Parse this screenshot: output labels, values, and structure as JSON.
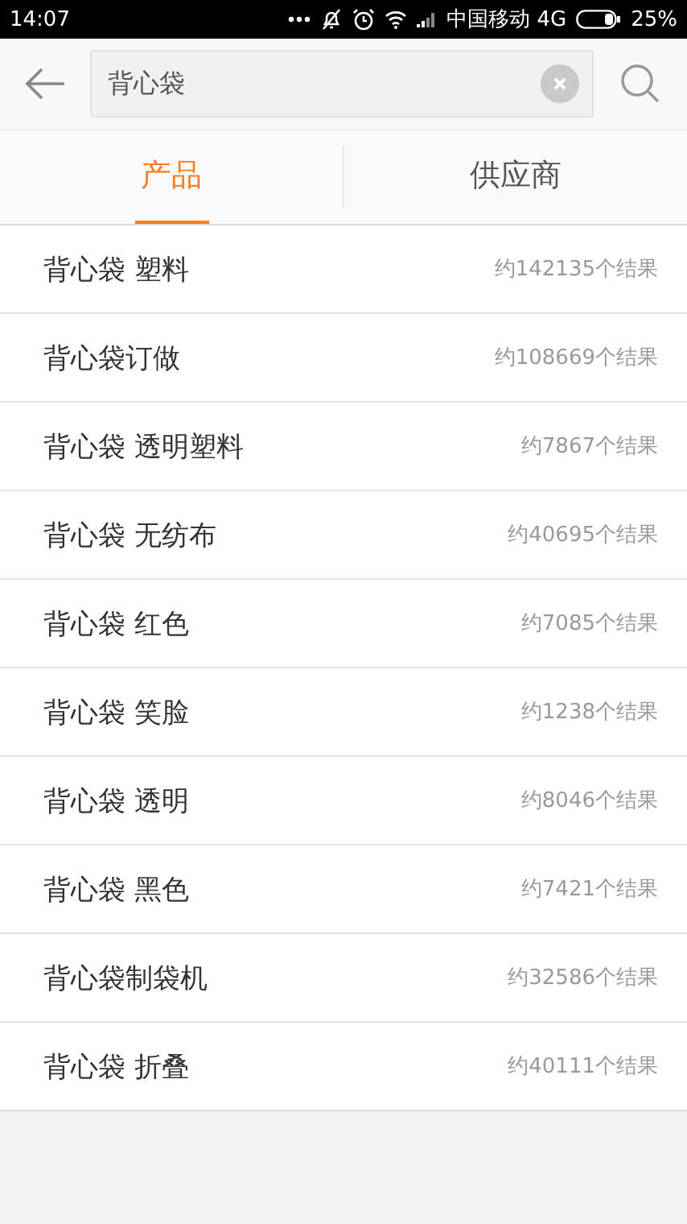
{
  "status_bar": {
    "time": "14:07",
    "carrier": "中国移动 4G",
    "battery": "25%"
  },
  "search": {
    "value": "背心袋"
  },
  "tabs": [
    {
      "label": "产品",
      "selected": true
    },
    {
      "label": "供应商",
      "selected": false
    }
  ],
  "results": [
    {
      "query": "背心袋 塑料",
      "count": "约142135个结果"
    },
    {
      "query": "背心袋订做",
      "count": "约108669个结果"
    },
    {
      "query": "背心袋 透明塑料",
      "count": "约7867个结果"
    },
    {
      "query": "背心袋 无纺布",
      "count": "约40695个结果"
    },
    {
      "query": "背心袋 红色",
      "count": "约7085个结果"
    },
    {
      "query": "背心袋 笑脸",
      "count": "约1238个结果"
    },
    {
      "query": "背心袋 透明",
      "count": "约8046个结果"
    },
    {
      "query": "背心袋 黑色",
      "count": "约7421个结果"
    },
    {
      "query": "背心袋制袋机",
      "count": "约32586个结果"
    },
    {
      "query": "背心袋 折叠",
      "count": "约40111个结果"
    }
  ]
}
